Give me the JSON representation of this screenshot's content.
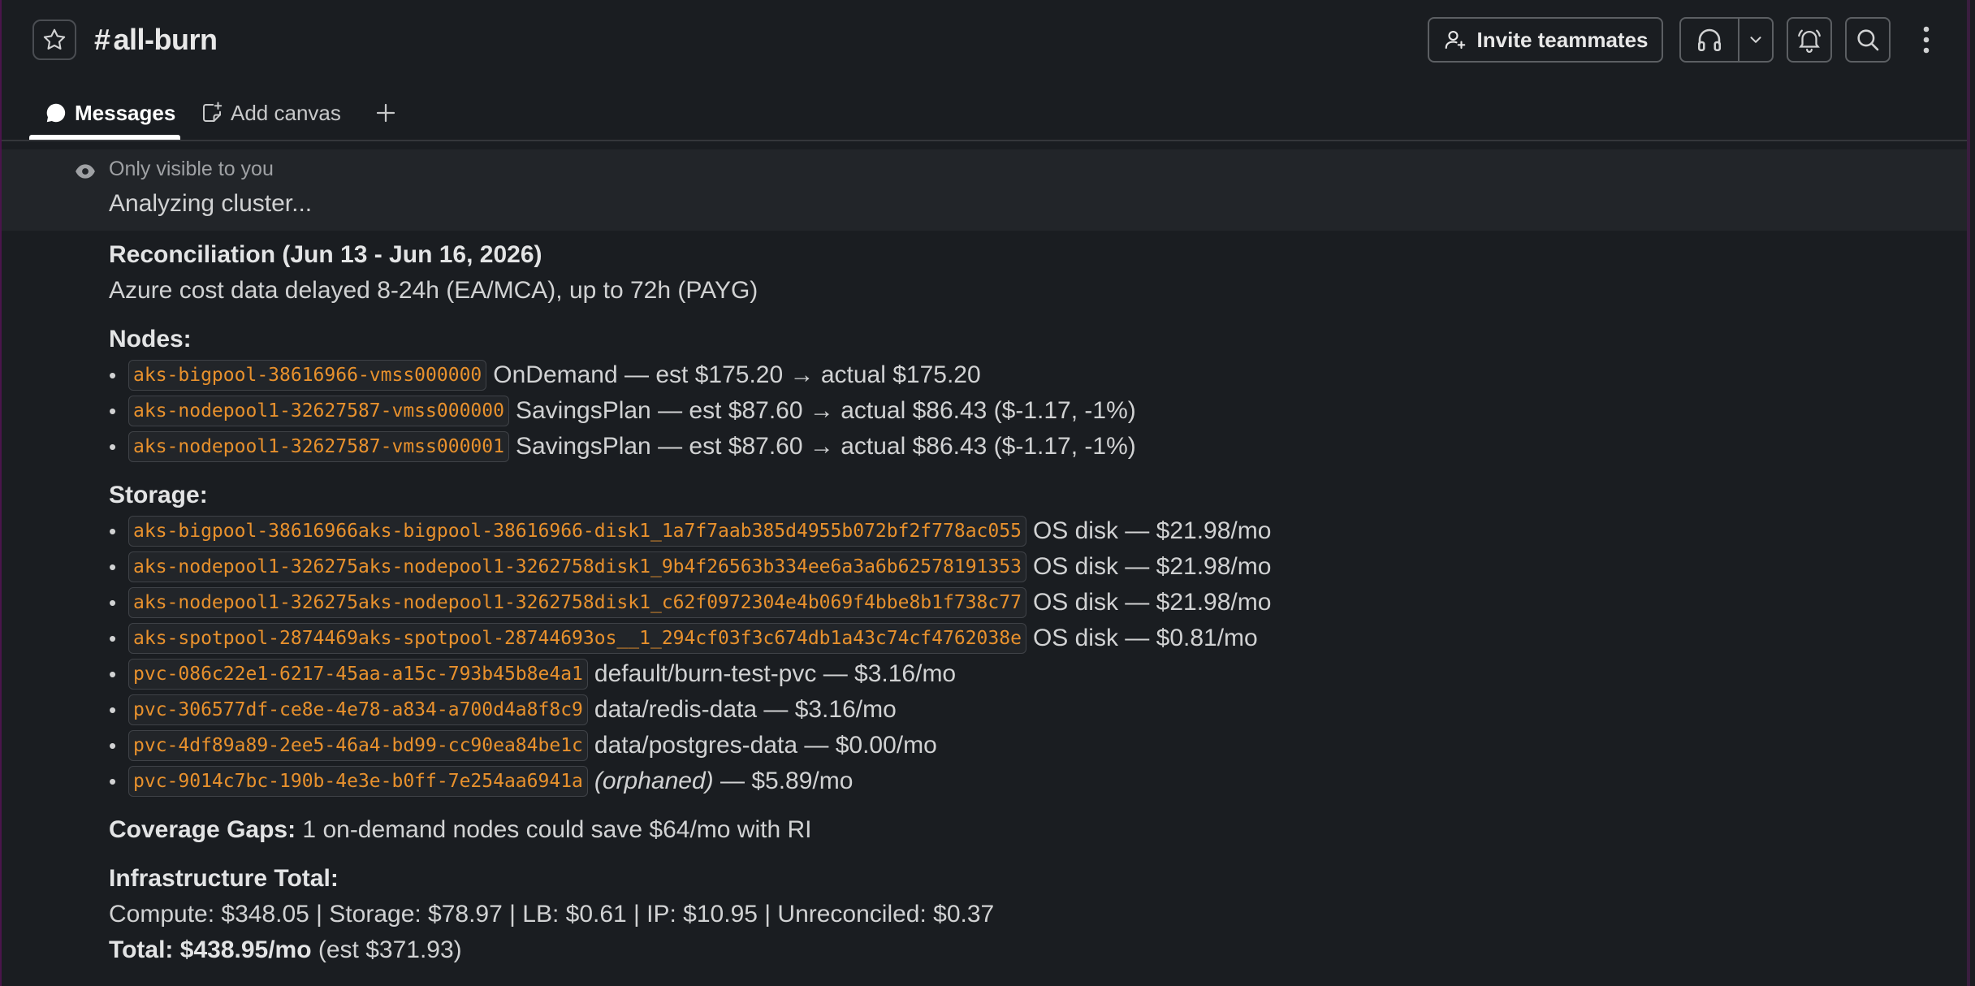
{
  "header": {
    "channel_name": "all-burn",
    "hash": "#",
    "invite_label": "Invite teammates"
  },
  "tabs": [
    {
      "label": "Messages",
      "active": true
    },
    {
      "label": "Add canvas",
      "active": false
    }
  ],
  "ephemeral": {
    "note": "Only visible to you",
    "text": "Analyzing cluster..."
  },
  "report": {
    "title": "Reconciliation (Jun 13 - Jun 16, 2026)",
    "delay_note": "Azure cost data delayed 8-24h (EA/MCA), up to 72h (PAYG)",
    "nodes_heading": "Nodes:",
    "nodes": [
      {
        "name": "aks-bigpool-38616966-vmss000000",
        "detail": "OnDemand — est $175.20 → actual $175.20"
      },
      {
        "name": "aks-nodepool1-32627587-vmss000000",
        "detail": "SavingsPlan — est $87.60 → actual $86.43 ($-1.17, -1%)"
      },
      {
        "name": "aks-nodepool1-32627587-vmss000001",
        "detail": "SavingsPlan — est $87.60 → actual $86.43 ($-1.17, -1%)"
      }
    ],
    "storage_heading": "Storage:",
    "storage": [
      {
        "name": "aks-bigpool-38616966aks-bigpool-38616966-disk1_1a7f7aab385d4955b072bf2f778ac055",
        "detail": "OS disk — $21.98/mo"
      },
      {
        "name": "aks-nodepool1-326275aks-nodepool1-3262758disk1_9b4f26563b334ee6a3a6b62578191353",
        "detail": "OS disk — $21.98/mo"
      },
      {
        "name": "aks-nodepool1-326275aks-nodepool1-3262758disk1_c62f0972304e4b069f4bbe8b1f738c77",
        "detail": "OS disk — $21.98/mo"
      },
      {
        "name": "aks-spotpool-2874469aks-spotpool-28744693os__1_294cf03f3c674db1a43c74cf4762038e",
        "detail": "OS disk — $0.81/mo"
      },
      {
        "name": "pvc-086c22e1-6217-45aa-a15c-793b45b8e4a1",
        "detail": "default/burn-test-pvc — $3.16/mo"
      },
      {
        "name": "pvc-306577df-ce8e-4e78-a834-a700d4a8f8c9",
        "detail": "data/redis-data — $3.16/mo"
      },
      {
        "name": "pvc-4df89a89-2ee5-46a4-bd99-cc90ea84be1c",
        "detail": "data/postgres-data — $0.00/mo"
      },
      {
        "name": "pvc-9014c7bc-190b-4e3e-b0ff-7e254aa6941a",
        "detail_italic": "(orphaned)",
        "detail": " — $5.89/mo"
      }
    ],
    "coverage_label": "Coverage Gaps:",
    "coverage_text": " 1 on-demand nodes could save $64/mo with RI",
    "infra_heading": "Infrastructure Total:",
    "infra_breakdown": "Compute: $348.05 | Storage: $78.97 | LB: $0.61 | IP: $10.95 | Unreconciled: $0.37",
    "total_label": "Total: $438.95/mo",
    "total_est": " (est $371.93)"
  }
}
